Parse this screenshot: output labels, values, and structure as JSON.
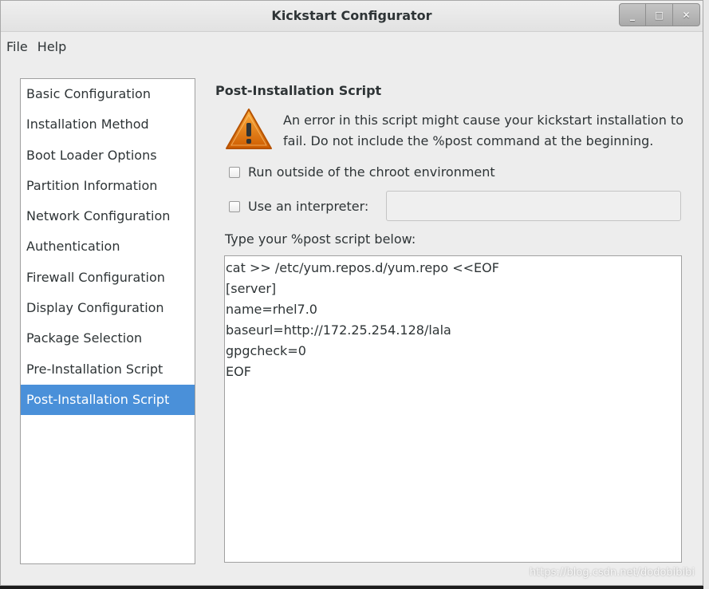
{
  "window": {
    "title": "Kickstart Configurator",
    "controls": {
      "minimize": "_",
      "maximize": "□",
      "close": "✕"
    }
  },
  "menubar": {
    "items": [
      "File",
      "Help"
    ]
  },
  "sidebar": {
    "items": [
      {
        "label": "Basic Configuration"
      },
      {
        "label": "Installation Method"
      },
      {
        "label": "Boot Loader Options"
      },
      {
        "label": "Partition Information"
      },
      {
        "label": "Network Configuration"
      },
      {
        "label": "Authentication"
      },
      {
        "label": "Firewall Configuration"
      },
      {
        "label": "Display Configuration"
      },
      {
        "label": "Package Selection"
      },
      {
        "label": "Pre-Installation Script"
      },
      {
        "label": "Post-Installation Script",
        "selected": true
      }
    ]
  },
  "main": {
    "heading": "Post-Installation Script",
    "warning_text": "An error in this script might cause your kickstart installation to fail. Do not include the %post command at the beginning.",
    "chroot_checkbox": {
      "label": "Run outside of the chroot environment",
      "checked": false
    },
    "interpreter_checkbox": {
      "label": "Use an interpreter:",
      "checked": false
    },
    "interpreter_value": "",
    "script_label": "Type your %post script below:",
    "script_lines": [
      "cat >> /etc/yum.repos.d/yum.repo <<EOF",
      "[server]",
      "name=rhel7.0",
      "baseurl=http://172.25.254.128/lala",
      "gpgcheck=0",
      "EOF"
    ]
  },
  "watermark": "https://blog.csdn.net/dodobibibi",
  "colors": {
    "selection": "#4a90d9",
    "warning_icon": "#f57900"
  }
}
